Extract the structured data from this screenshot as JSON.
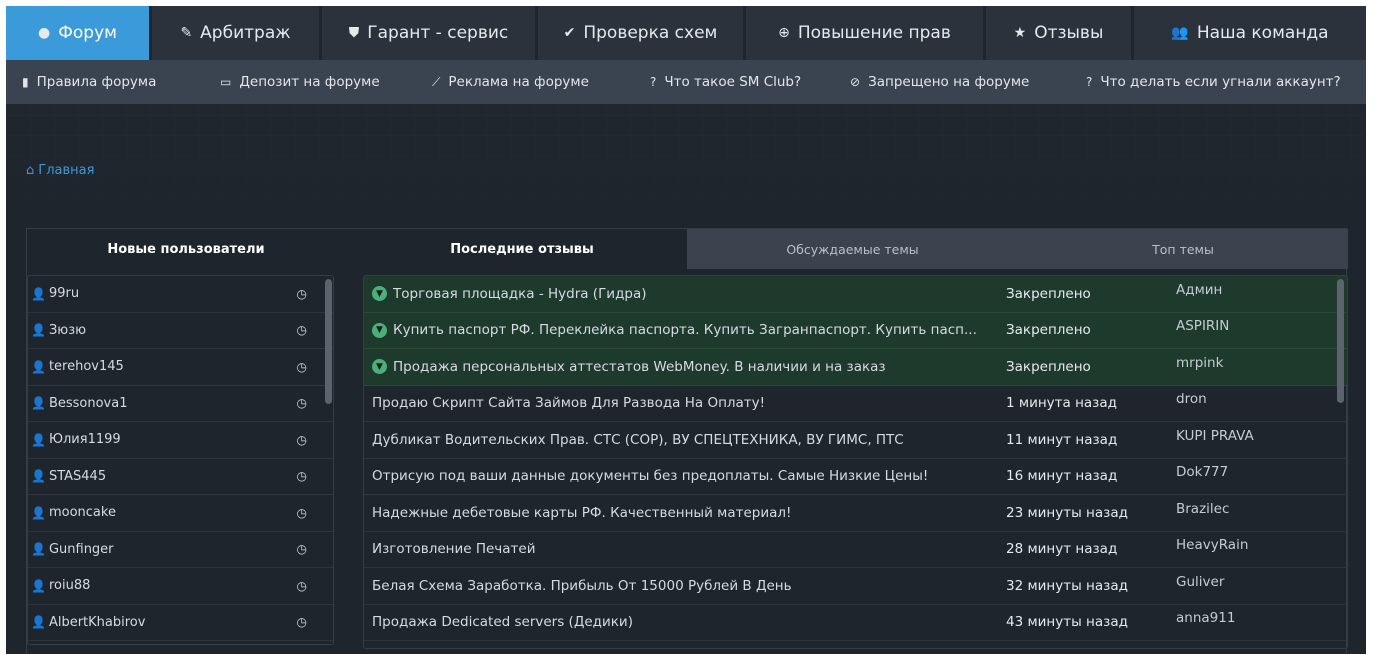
{
  "topnav": {
    "tabs": [
      {
        "label": "Форум",
        "icon": "comments-icon",
        "glyph": "●",
        "active": true
      },
      {
        "label": "Арбитраж",
        "icon": "gavel-icon",
        "glyph": "✎",
        "active": false
      },
      {
        "label": "Гарант - сервис",
        "icon": "shield-icon",
        "glyph": "⛊",
        "active": false
      },
      {
        "label": "Проверка схем",
        "icon": "check-circle-icon",
        "glyph": "✔",
        "active": false
      },
      {
        "label": "Повышение прав",
        "icon": "arrow-up-circle-icon",
        "glyph": "⊕",
        "active": false
      },
      {
        "label": "Отзывы",
        "icon": "star-icon",
        "glyph": "★",
        "active": false
      },
      {
        "label": "Наша команда",
        "icon": "users-icon",
        "glyph": "👥",
        "active": false
      }
    ]
  },
  "subnav": {
    "items": [
      {
        "label": "Правила форума",
        "icon": "book-icon",
        "glyph": "▮"
      },
      {
        "label": "Депозит на форуме",
        "icon": "credit-card-icon",
        "glyph": "▭"
      },
      {
        "label": "Реклама на форуме",
        "icon": "line-chart-icon",
        "glyph": "⟋"
      },
      {
        "label": "Что такое SM Club?",
        "icon": "question-circle-icon",
        "glyph": "?"
      },
      {
        "label": "Запрещено на форуме",
        "icon": "ban-icon",
        "glyph": "⊘"
      },
      {
        "label": "Что делать если угнали аккаунт?",
        "icon": "question-circle-icon",
        "glyph": "?"
      }
    ]
  },
  "breadcrumb": {
    "icon": "home-icon",
    "label": "Главная"
  },
  "panel": {
    "left_title": "Новые пользователи",
    "tabs": [
      {
        "label": "Последние отзывы",
        "active": true
      },
      {
        "label": "Обсуждаемые темы",
        "active": false
      },
      {
        "label": "Топ темы",
        "active": false
      }
    ]
  },
  "users": [
    {
      "name": "99ru"
    },
    {
      "name": "Зюзю"
    },
    {
      "name": "terehov145"
    },
    {
      "name": "Bessonova1"
    },
    {
      "name": "Юлия1199"
    },
    {
      "name": "STAS445"
    },
    {
      "name": "mooncake"
    },
    {
      "name": "Gunfinger"
    },
    {
      "name": "roiu88"
    },
    {
      "name": "AlbertKhabirov"
    }
  ],
  "topics": [
    {
      "title": "Торговая площадка - Hydra (Гидра)",
      "when": "Закреплено",
      "author": "Админ",
      "pinned": true
    },
    {
      "title": "Купить паспорт РФ. Переклейка паспорта. Купить Загранпаспорт. Купить пасп...",
      "when": "Закреплено",
      "author": "ASPIRIN",
      "pinned": true
    },
    {
      "title": "Продажа персональных аттестатов WebMoney. В наличии и на заказ",
      "when": "Закреплено",
      "author": "mrpink",
      "pinned": true
    },
    {
      "title": "Продаю Скрипт Сайта Займов Для Развода На Оплату!",
      "when": "1 минута назад",
      "author": "dron",
      "pinned": false
    },
    {
      "title": "Дубликат Водительских Прав. СТС (СОР), ВУ СПЕЦТЕХНИКА, ВУ ГИМС, ПТС",
      "when": "11 минут назад",
      "author": "KUPI PRAVA",
      "pinned": false
    },
    {
      "title": "Отрисую под ваши данные документы без предоплаты. Самые Низкие Цены!",
      "when": "16 минут назад",
      "author": "Dok777",
      "pinned": false
    },
    {
      "title": "Надежные дебетовые карты РФ. Качественный материал!",
      "when": "23 минуты назад",
      "author": "Brazilec",
      "pinned": false
    },
    {
      "title": "Изготовление Печатей",
      "when": "28 минут назад",
      "author": "HeavyRain",
      "pinned": false
    },
    {
      "title": "Белая Схема Заработка. Прибыль От 15000 Рублей В День",
      "when": "32 минуты назад",
      "author": "Guliver",
      "pinned": false
    },
    {
      "title": "Продажа Dedicated servers (Дедики)",
      "when": "43 минуты назад",
      "author": "anna911",
      "pinned": false
    }
  ]
}
